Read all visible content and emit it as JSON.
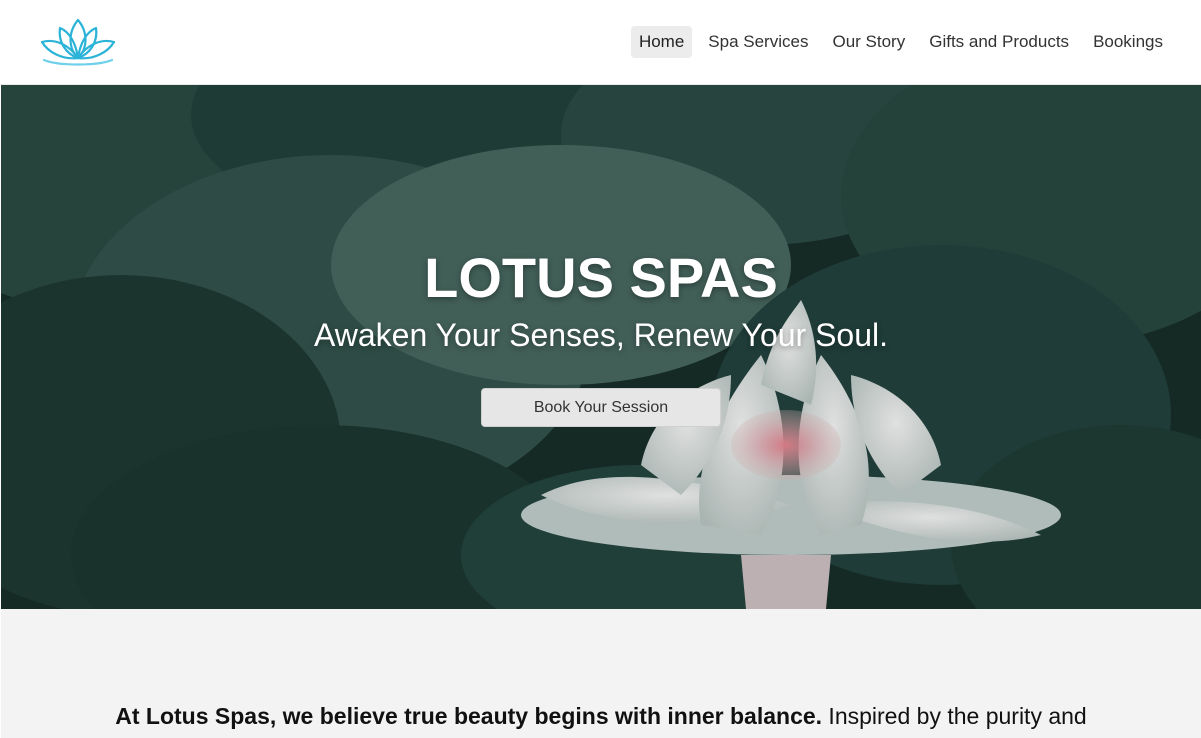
{
  "header": {
    "logo_icon": "lotus-logo-icon",
    "nav": [
      {
        "label": "Home",
        "active": true
      },
      {
        "label": "Spa Services",
        "active": false
      },
      {
        "label": "Our Story",
        "active": false
      },
      {
        "label": "Gifts and Products",
        "active": false
      },
      {
        "label": "Bookings",
        "active": false
      }
    ]
  },
  "hero": {
    "title": "LOTUS SPAS",
    "subtitle": "Awaken Your Senses, Renew Your Soul.",
    "button_label": "Book Your Session",
    "background": "lotus-flower-on-lily-pads"
  },
  "about": {
    "intro_bold": "At Lotus Spas, we believe true beauty begins with inner balance.",
    "intro_rest": " Inspired by the purity and"
  },
  "colors": {
    "logo_accent": "#2bb3d8",
    "hero_dark": "#1b3530",
    "section_bg": "#f3f3f3",
    "nav_active_bg": "#ececec"
  }
}
